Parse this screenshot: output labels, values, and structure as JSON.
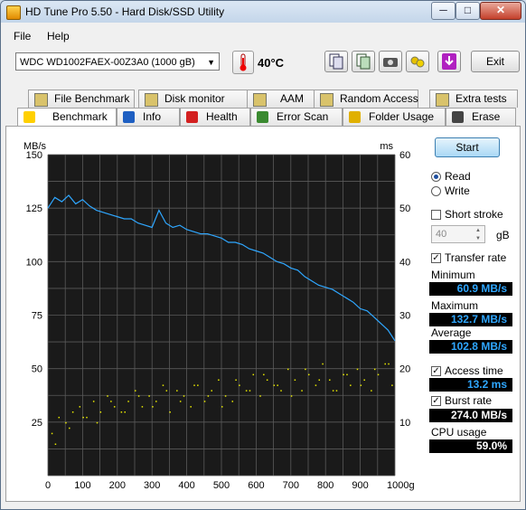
{
  "window": {
    "title": "HD Tune Pro 5.50 - Hard Disk/SSD Utility",
    "minimize": "─",
    "maximize": "□",
    "close": "✕"
  },
  "menu": {
    "file": "File",
    "help": "Help"
  },
  "toolbar": {
    "drive": "WDC WD1002FAEX-00Z3A0 (1000 gB)",
    "temperature": "40°C",
    "exit_label": "Exit",
    "icons": [
      "copy-icon",
      "copy-all-icon",
      "camera-icon",
      "options-icon",
      "save-icon"
    ]
  },
  "tabs_top": [
    {
      "label": "File Benchmark",
      "icon": "file-benchmark-icon"
    },
    {
      "label": "Disk monitor",
      "icon": "disk-monitor-icon"
    },
    {
      "label": "AAM",
      "icon": "speaker-icon"
    },
    {
      "label": "Random Access",
      "icon": "random-access-icon"
    },
    {
      "label": "Extra tests",
      "icon": "extra-tests-icon"
    }
  ],
  "tabs_bottom": [
    {
      "label": "Benchmark",
      "icon": "lightbulb-icon",
      "active": true
    },
    {
      "label": "Info",
      "icon": "info-icon"
    },
    {
      "label": "Health",
      "icon": "health-cross-icon"
    },
    {
      "label": "Error Scan",
      "icon": "magnifier-icon"
    },
    {
      "label": "Folder Usage",
      "icon": "folder-icon"
    },
    {
      "label": "Erase",
      "icon": "trash-icon"
    }
  ],
  "side": {
    "start_label": "Start",
    "read_label": "Read",
    "write_label": "Write",
    "short_stroke_label": "Short stroke",
    "short_stroke_value": "40",
    "short_stroke_unit": "gB",
    "transfer_rate_label": "Transfer rate",
    "minimum_label": "Minimum",
    "minimum_value": "60.9 MB/s",
    "maximum_label": "Maximum",
    "maximum_value": "132.7 MB/s",
    "average_label": "Average",
    "average_value": "102.8 MB/s",
    "access_time_label": "Access time",
    "access_time_value": "13.2 ms",
    "burst_rate_label": "Burst rate",
    "burst_rate_value": "274.0 MB/s",
    "cpu_usage_label": "CPU usage",
    "cpu_usage_value": "59.0%"
  },
  "chart_data": {
    "type": "line",
    "ylabel_left": "MB/s",
    "ylabel_right": "ms",
    "x_ticks": [
      "0",
      "100",
      "200",
      "300",
      "400",
      "500",
      "600",
      "700",
      "800",
      "900",
      "1000gB"
    ],
    "y_ticks_left": [
      "150",
      "125",
      "100",
      "75",
      "50",
      "25"
    ],
    "y_ticks_right": [
      "60",
      "50",
      "40",
      "30",
      "20",
      "10"
    ],
    "xlim": [
      0,
      1000
    ],
    "ylim_left": [
      0,
      150
    ],
    "ylim_right": [
      0,
      60
    ],
    "background": "#1a1a1a",
    "grid": true,
    "line_color": "#2fa7ff",
    "scatter_color": "#e8e800",
    "transfer_rate": {
      "x": [
        0,
        20,
        40,
        60,
        80,
        100,
        120,
        140,
        160,
        180,
        200,
        220,
        240,
        260,
        280,
        300,
        320,
        340,
        360,
        380,
        400,
        420,
        440,
        460,
        480,
        500,
        520,
        540,
        560,
        580,
        600,
        620,
        640,
        660,
        680,
        700,
        720,
        740,
        760,
        780,
        800,
        820,
        840,
        860,
        880,
        900,
        920,
        940,
        960,
        980,
        1000
      ],
      "values": [
        125,
        130,
        128,
        131,
        127,
        129,
        126,
        124,
        123,
        122,
        121,
        120,
        120,
        118,
        117,
        116,
        124,
        118,
        116,
        117,
        115,
        114,
        113,
        113,
        112,
        111,
        109,
        109,
        108,
        106,
        105,
        104,
        102,
        100,
        99,
        97,
        96,
        93,
        91,
        89,
        88,
        87,
        85,
        83,
        81,
        78,
        77,
        74,
        71,
        68,
        63
      ]
    },
    "access_time_ms": {
      "x": [
        10,
        30,
        50,
        70,
        90,
        110,
        130,
        150,
        170,
        190,
        210,
        230,
        250,
        270,
        290,
        310,
        330,
        350,
        370,
        390,
        410,
        430,
        450,
        470,
        490,
        510,
        530,
        550,
        570,
        590,
        610,
        630,
        650,
        670,
        690,
        710,
        730,
        750,
        770,
        790,
        810,
        830,
        850,
        870,
        890,
        910,
        930,
        950,
        970,
        990,
        20,
        60,
        100,
        140,
        180,
        220,
        260,
        300,
        340,
        380,
        420,
        460,
        500,
        540,
        580,
        620,
        660,
        700,
        740,
        780,
        820,
        860,
        900,
        940,
        980
      ],
      "values": [
        8,
        11,
        10,
        12,
        13,
        11,
        14,
        12,
        15,
        13,
        12,
        14,
        16,
        13,
        15,
        14,
        17,
        12,
        16,
        15,
        13,
        17,
        14,
        16,
        18,
        15,
        14,
        17,
        16,
        19,
        15,
        18,
        17,
        16,
        20,
        18,
        16,
        19,
        17,
        21,
        18,
        16,
        19,
        17,
        20,
        18,
        16,
        19,
        21,
        17,
        6,
        9,
        11,
        10,
        14,
        12,
        15,
        13,
        16,
        14,
        17,
        15,
        13,
        18,
        16,
        19,
        17,
        15,
        20,
        18,
        16,
        19,
        17,
        20,
        21
      ]
    }
  }
}
